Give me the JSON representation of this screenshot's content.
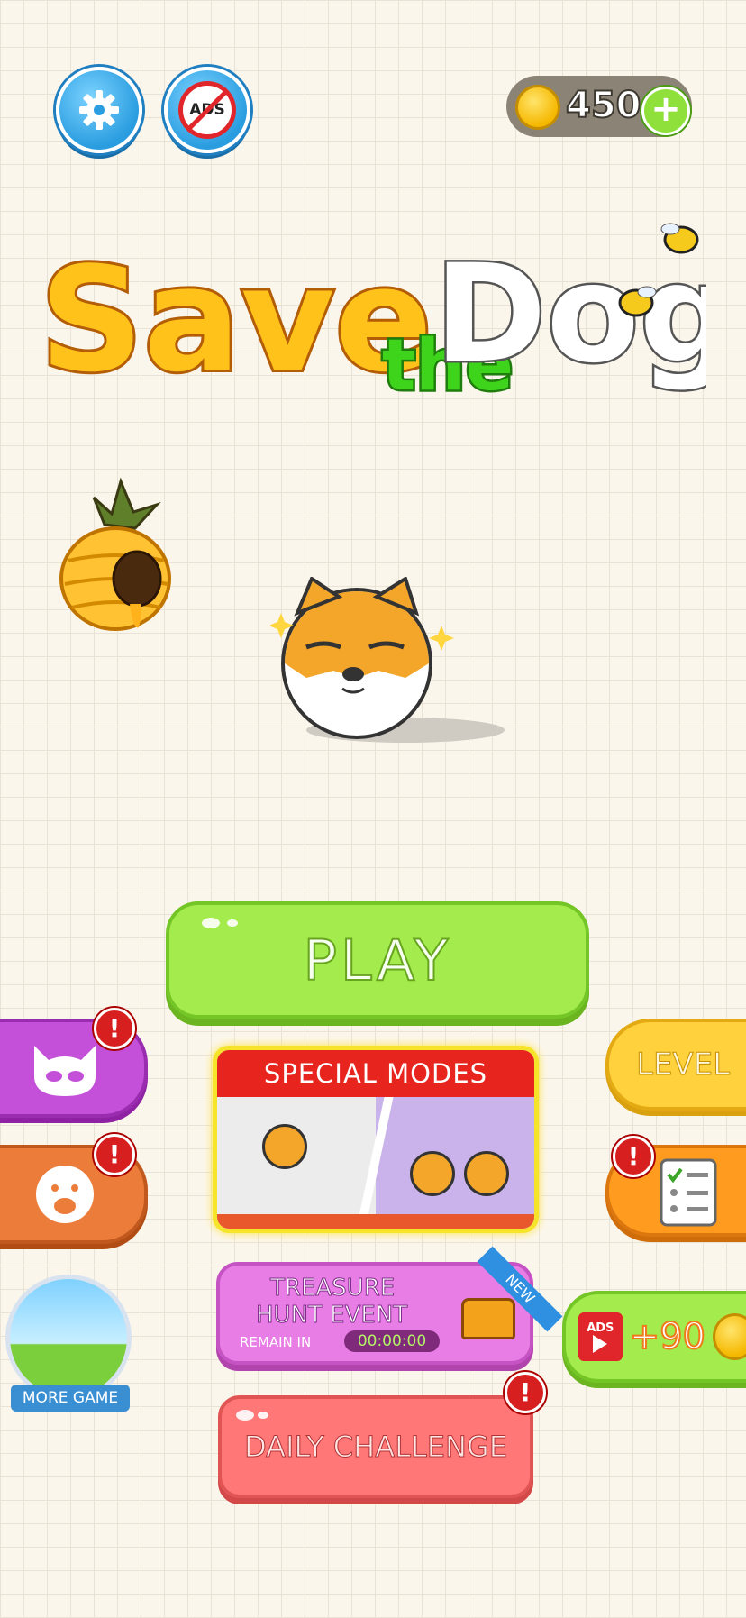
{
  "header": {
    "coins": "450",
    "plus_label": "+",
    "no_ads_label": "ADS"
  },
  "logo": {
    "save": "Save",
    "the": "the",
    "dog": "Dog"
  },
  "buttons": {
    "play": "PLAY",
    "special_modes": "SPECIAL MODES",
    "level": "LEVEL",
    "treasure_line1": "TREASURE",
    "treasure_line2": "HUNT EVENT",
    "remain_in": "REMAIN IN",
    "timer": "00:00:00",
    "new_ribbon": "NEW",
    "daily_challenge": "DAILY CHALLENGE",
    "more_game": "MORE GAME",
    "reward_amount": "+90",
    "reward_ads": "ADS",
    "badge": "!"
  },
  "colors": {
    "play": "#a4ec4d",
    "skins": "#c44fd8",
    "emotes": "#ec7c3a",
    "level": "#ffd23d",
    "tasks": "#ff9c1f",
    "reward": "#a4ec4d"
  }
}
